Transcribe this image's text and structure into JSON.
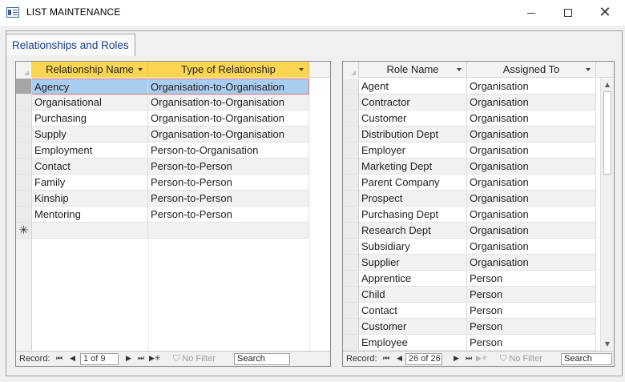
{
  "window": {
    "title": "LIST MAINTENANCE",
    "minimize_glyph": "",
    "maximize_glyph": "",
    "close_glyph": "✕"
  },
  "tab": {
    "label": "Relationships and Roles"
  },
  "left_table": {
    "columns": [
      "Relationship Name",
      "Type of Relationship"
    ],
    "rows": [
      [
        "Agency",
        "Organisation-to-Organisation"
      ],
      [
        "Organisational",
        "Organisation-to-Organisation"
      ],
      [
        "Purchasing",
        "Organisation-to-Organisation"
      ],
      [
        "Supply",
        "Organisation-to-Organisation"
      ],
      [
        "Employment",
        "Person-to-Organisation"
      ],
      [
        "Contact",
        "Person-to-Person"
      ],
      [
        "Family",
        "Person-to-Person"
      ],
      [
        "Kinship",
        "Person-to-Person"
      ],
      [
        "Mentoring",
        "Person-to-Person"
      ]
    ],
    "new_record_marker": "✳",
    "nav": {
      "record_label": "Record:",
      "position": "1 of 9",
      "filter_label": "No Filter",
      "search": "Search"
    }
  },
  "right_table": {
    "columns": [
      "Role Name",
      "Assigned To"
    ],
    "rows": [
      [
        "Agent",
        "Organisation"
      ],
      [
        "Contractor",
        "Organisation"
      ],
      [
        "Customer",
        "Organisation"
      ],
      [
        "Distribution Dept",
        "Organisation"
      ],
      [
        "Employer",
        "Organisation"
      ],
      [
        "Marketing Dept",
        "Organisation"
      ],
      [
        "Parent Company",
        "Organisation"
      ],
      [
        "Prospect",
        "Organisation"
      ],
      [
        "Purchasing Dept",
        "Organisation"
      ],
      [
        "Research Dept",
        "Organisation"
      ],
      [
        "Subsidiary",
        "Organisation"
      ],
      [
        "Supplier",
        "Organisation"
      ],
      [
        "Apprentice",
        "Person"
      ],
      [
        "Child",
        "Person"
      ],
      [
        "Contact",
        "Person"
      ],
      [
        "Customer",
        "Person"
      ],
      [
        "Employee",
        "Person"
      ]
    ],
    "nav": {
      "record_label": "Record:",
      "position": "26 of 26",
      "filter_label": "No Filter",
      "search": "Search"
    }
  },
  "colors": {
    "header_gold": "#fcd653",
    "selected_row": "#a9cdf0",
    "selected_border": "#e86f76",
    "tab_text": "#1a3e92"
  }
}
